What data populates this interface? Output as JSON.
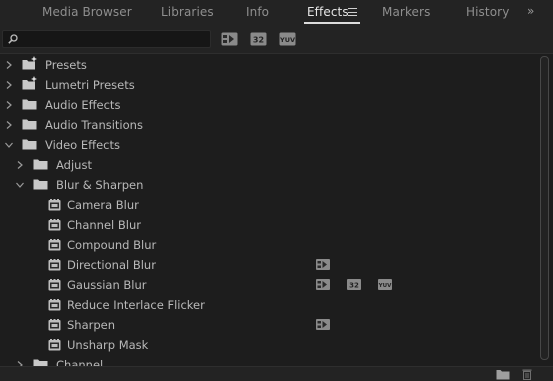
{
  "tabs": [
    {
      "label": "Media Browser",
      "active": false
    },
    {
      "label": "Libraries",
      "active": false
    },
    {
      "label": "Info",
      "active": false
    },
    {
      "label": "Effects",
      "active": true
    },
    {
      "label": "Markers",
      "active": false
    },
    {
      "label": "History",
      "active": false
    }
  ],
  "overflow_glyph": "»",
  "search": {
    "value": "",
    "placeholder": ""
  },
  "filter_buttons": [
    {
      "icon": "accelerated-effects-icon",
      "text": "⚡"
    },
    {
      "icon": "32-bit-color-icon",
      "text": "32"
    },
    {
      "icon": "yuv-effects-icon",
      "text": "YUV"
    }
  ],
  "tree": [
    {
      "label": "Presets",
      "kind": "preset-folder",
      "expanded": false
    },
    {
      "label": "Lumetri Presets",
      "kind": "preset-folder",
      "expanded": false
    },
    {
      "label": "Audio Effects",
      "kind": "folder",
      "expanded": false
    },
    {
      "label": "Audio Transitions",
      "kind": "folder",
      "expanded": false
    },
    {
      "label": "Video Effects",
      "kind": "folder",
      "expanded": true
    },
    {
      "label": "Adjust",
      "kind": "folder",
      "expanded": false
    },
    {
      "label": "Blur & Sharpen",
      "kind": "folder",
      "expanded": true
    },
    {
      "label": "Camera Blur",
      "kind": "effect"
    },
    {
      "label": "Channel Blur",
      "kind": "effect"
    },
    {
      "label": "Compound Blur",
      "kind": "effect"
    },
    {
      "label": "Directional Blur",
      "kind": "effect",
      "badges": [
        "accelerated"
      ]
    },
    {
      "label": "Gaussian Blur",
      "kind": "effect",
      "badges": [
        "accelerated",
        "32",
        "yuv"
      ]
    },
    {
      "label": "Reduce Interlace Flicker",
      "kind": "effect"
    },
    {
      "label": "Sharpen",
      "kind": "effect",
      "badges": [
        "accelerated"
      ]
    },
    {
      "label": "Unsharp Mask",
      "kind": "effect"
    },
    {
      "label": "Channel",
      "kind": "folder",
      "expanded": false
    }
  ],
  "bottom_icons": [
    "new-bin-icon",
    "trash-icon"
  ],
  "colors": {
    "background": "#1d1d1d",
    "header": "#232323",
    "text": "#b9b9b9",
    "active_tab": "#e6e6e6"
  }
}
